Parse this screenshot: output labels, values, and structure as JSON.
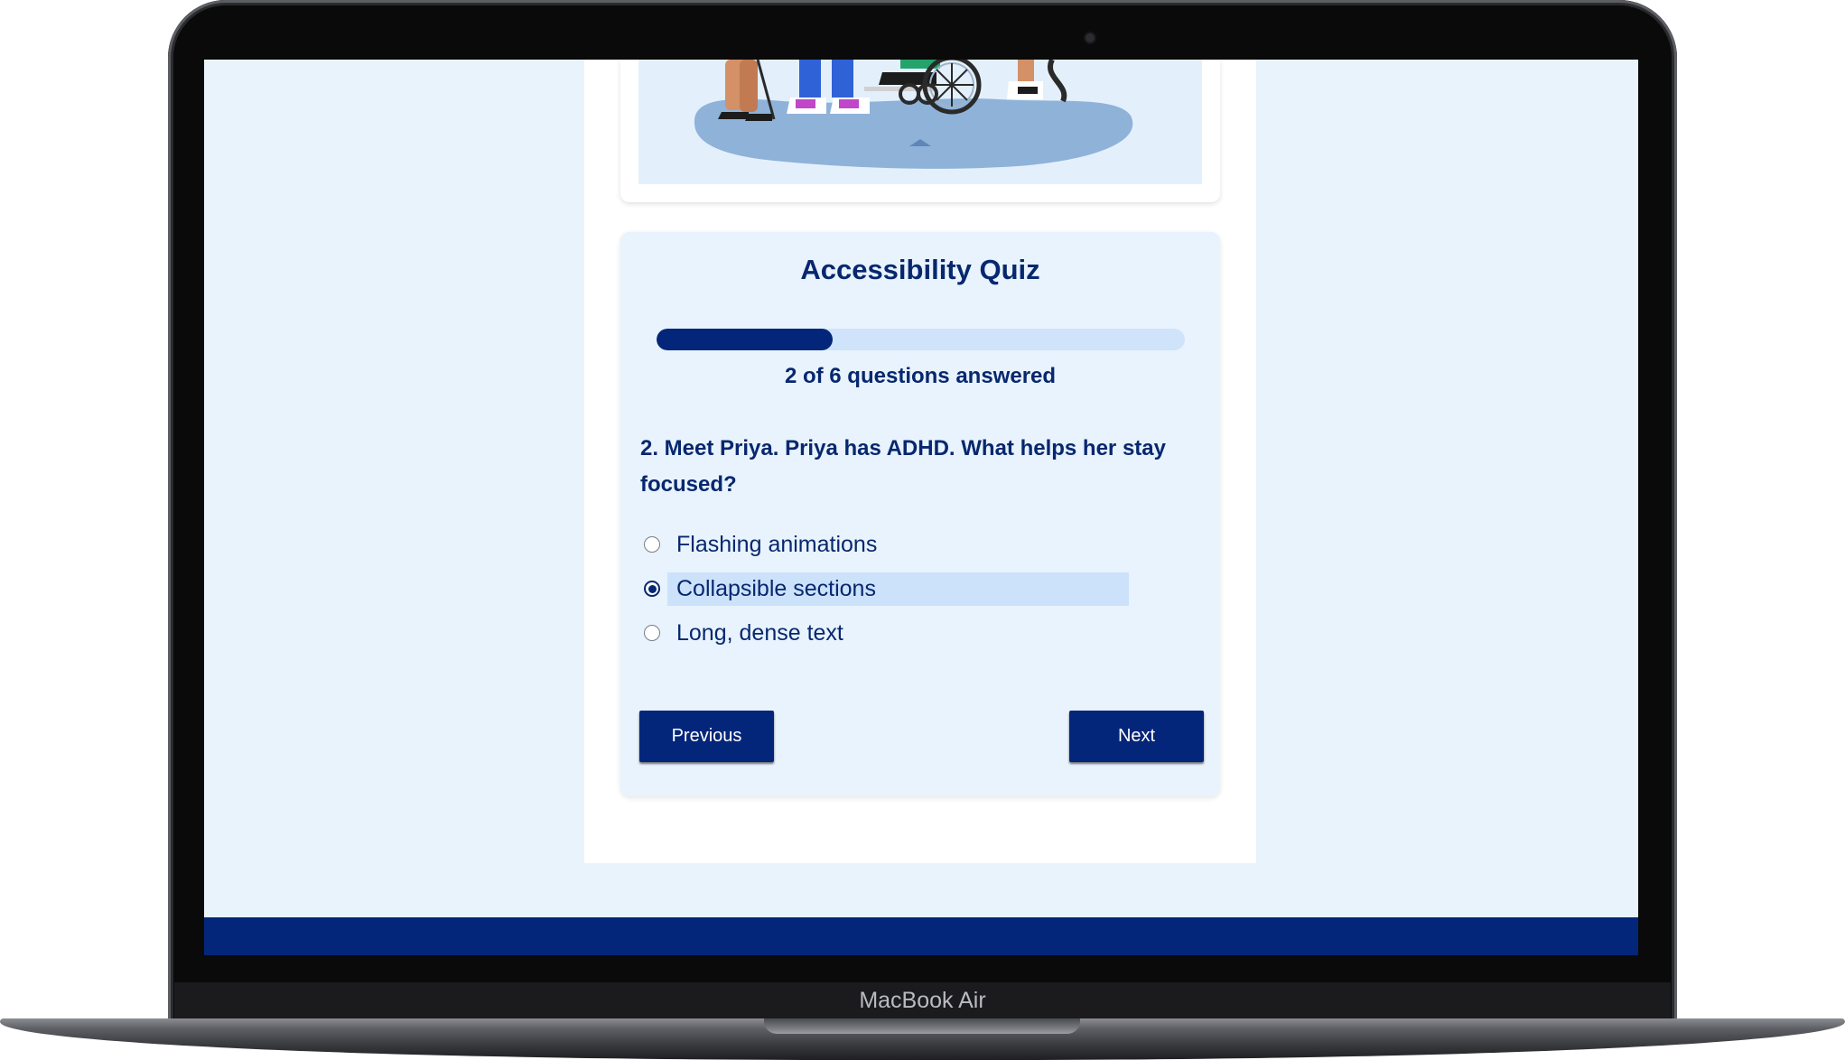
{
  "device": {
    "label": "MacBook Air"
  },
  "quiz": {
    "title": "Accessibility Quiz",
    "progress": {
      "answered": 2,
      "total": 6,
      "fraction": 0.3333,
      "text": "2 of 6 questions answered"
    },
    "question": "2. Meet Priya. Priya has ADHD. What helps her stay focused?",
    "options": [
      {
        "label": "Flashing animations",
        "selected": false
      },
      {
        "label": "Collapsible sections",
        "selected": true
      },
      {
        "label": "Long, dense text",
        "selected": false
      }
    ],
    "buttons": {
      "previous": "Previous",
      "next": "Next"
    }
  },
  "colors": {
    "navy": "#04267a",
    "text": "#07276f",
    "page_bg": "#e9f3fc",
    "track": "#cfe3fa",
    "highlight": "#cce2fb"
  }
}
